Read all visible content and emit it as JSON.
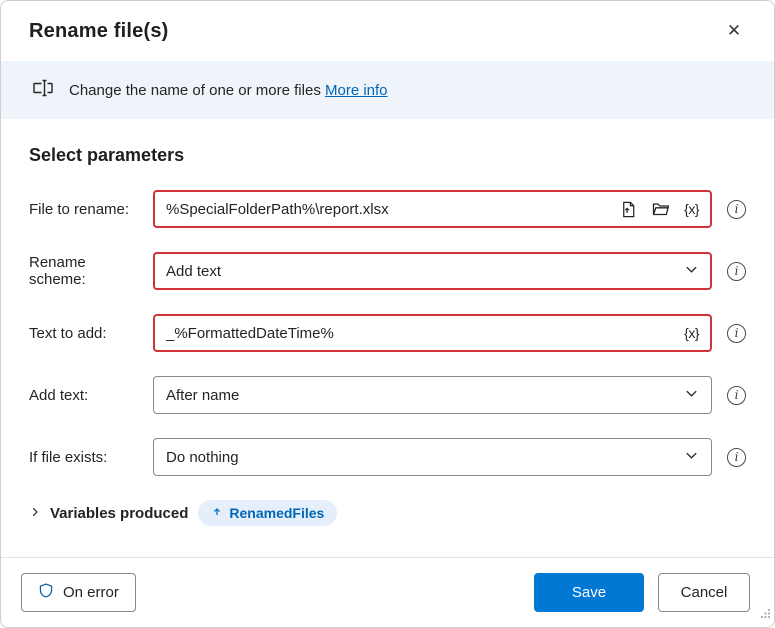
{
  "colors": {
    "accent": "#0078d4",
    "highlight_border": "#d13438",
    "banner_background": "#eff4fb",
    "link": "#0067b8",
    "pill_background": "#e4effb"
  },
  "dialog": {
    "title": "Rename file(s)",
    "close_icon": "✕"
  },
  "banner": {
    "icon": "rename-icon",
    "text": "Change the name of one or more files",
    "link_text": "More info"
  },
  "section": {
    "title": "Select parameters"
  },
  "fields": [
    {
      "label": "File to rename:",
      "value": "%SpecialFolderPath%\\report.xlsx",
      "control": "text",
      "icons": [
        "select-file-icon",
        "select-folder-icon",
        "variable-picker-icon"
      ],
      "highlighted": true
    },
    {
      "label": "Rename scheme:",
      "value": "Add text",
      "control": "select",
      "highlighted": true
    },
    {
      "label": "Text to add:",
      "value": "_%FormattedDateTime%",
      "control": "text",
      "icons": [
        "variable-picker-icon"
      ],
      "highlighted": true
    },
    {
      "label": "Add text:",
      "value": "After name",
      "control": "select",
      "highlighted": false
    },
    {
      "label": "If file exists:",
      "value": "Do nothing",
      "control": "select",
      "highlighted": false
    }
  ],
  "glyphs": {
    "variable_picker": "{x}"
  },
  "variables_produced": {
    "label": "Variables produced",
    "variables": [
      "RenamedFiles"
    ]
  },
  "footer": {
    "on_error": "On error",
    "save": "Save",
    "cancel": "Cancel"
  }
}
